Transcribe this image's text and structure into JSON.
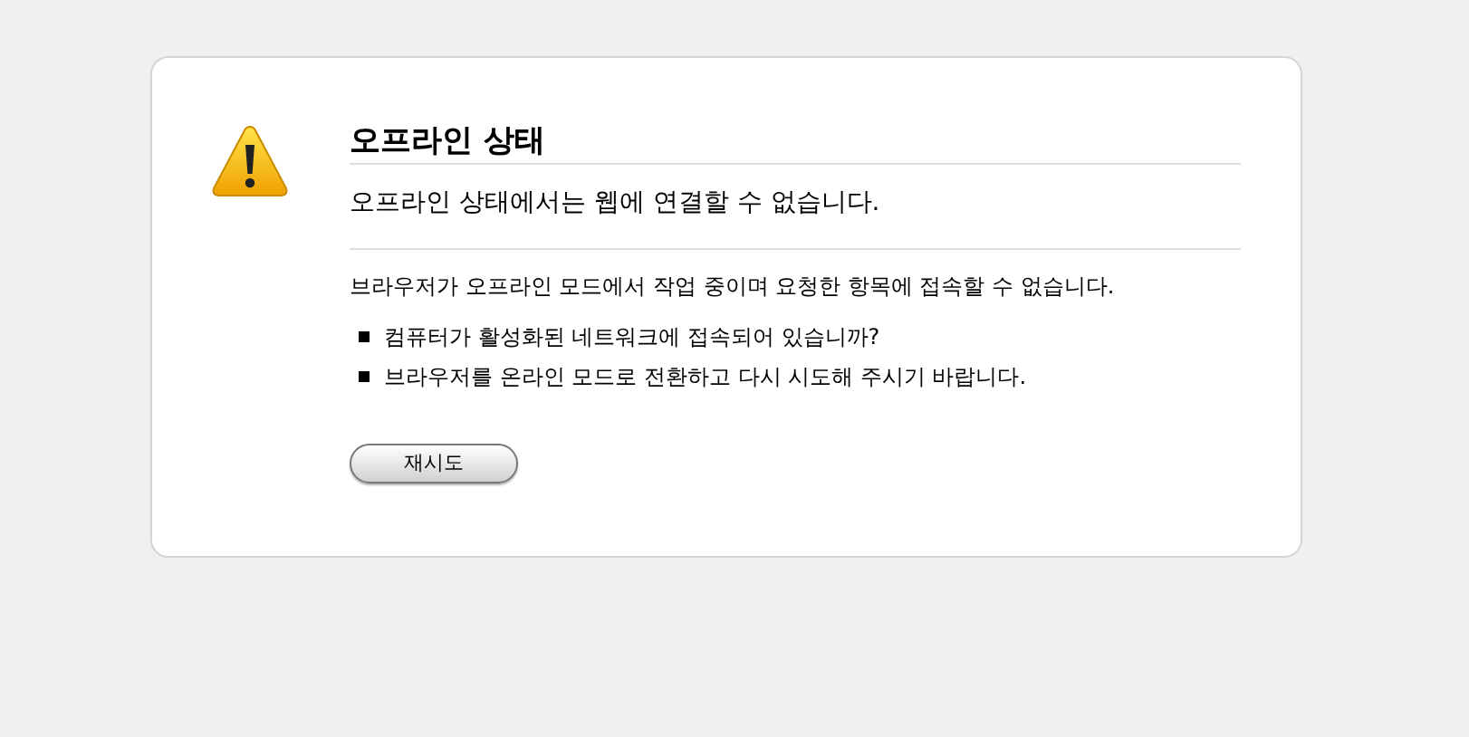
{
  "title": "오프라인 상태",
  "short_description": "오프라인 상태에서는 웹에 연결할 수 없습니다.",
  "long_description": "브라우저가 오프라인 모드에서 작업 중이며 요청한 항목에 접속할 수 없습니다.",
  "suggestions": [
    "컴퓨터가 활성화된 네트워크에 접속되어 있습니까?",
    "브라우저를 온라인 모드로 전환하고 다시 시도해 주시기 바랍니다."
  ],
  "button": {
    "label": "재시도"
  }
}
